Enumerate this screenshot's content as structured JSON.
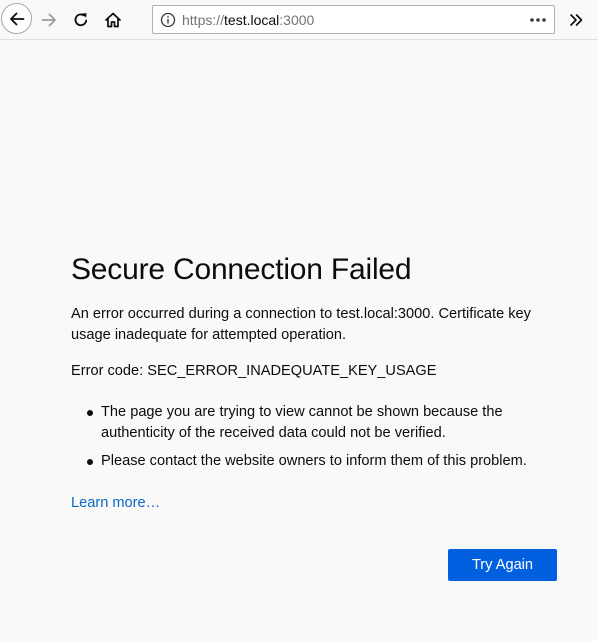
{
  "browser": {
    "url_scheme": "https://",
    "url_host": "test.local",
    "url_port": ":3000",
    "icons": {
      "back": "back-arrow-icon",
      "forward": "forward-arrow-icon",
      "reload": "reload-icon",
      "home": "home-icon",
      "info": "info-icon",
      "page_actions": "more-dots-icon",
      "overflow": "chevron-double-right-icon"
    }
  },
  "error_page": {
    "title": "Secure Connection Failed",
    "description": "An error occurred during a connection to test.local:3000. Certificate key usage inadequate for attempted operation.",
    "error_code": "Error code: SEC_ERROR_INADEQUATE_KEY_USAGE",
    "reasons": [
      "The page you are trying to view cannot be shown because the authenticity of the received data could not be verified.",
      "Please contact the website owners to inform them of this problem."
    ],
    "learn_more": "Learn more…",
    "try_again": "Try Again"
  },
  "colors": {
    "accent": "#0060df",
    "link": "#0a68c4",
    "background": "#f9f9fa",
    "text": "#0c0c0d"
  }
}
